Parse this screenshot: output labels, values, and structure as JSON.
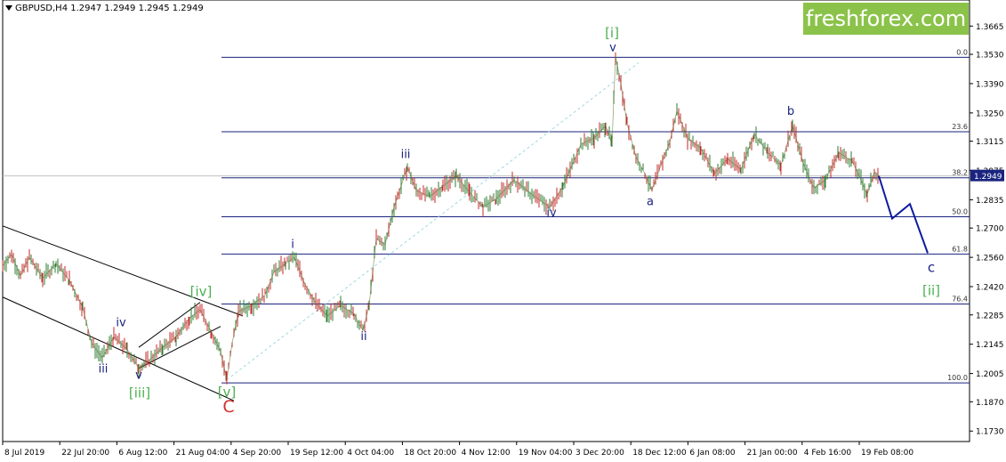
{
  "symbol": {
    "title": "GBPUSD,H4  1.2947 1.2949 1.2945 1.2949"
  },
  "logo": {
    "text": "freshforex.com"
  },
  "chart_data": {
    "type": "line",
    "ylim": [
      1.168,
      1.373
    ],
    "y_ticks": [
      "1.3665",
      "1.3530",
      "1.3390",
      "1.3250",
      "1.3115",
      "1.2975",
      "1.2835",
      "1.2700",
      "1.2560",
      "1.2420",
      "1.2285",
      "1.2145",
      "1.2005",
      "1.1870",
      "1.1730"
    ],
    "x_ticks": [
      "8 Jul 2019",
      "22 Jul 20:00",
      "6 Aug 12:00",
      "21 Aug 04:00",
      "4 Sep 20:00",
      "19 Sep 12:00",
      "4 Oct 04:00",
      "18 Oct 20:00",
      "4 Nov 12:00",
      "19 Nov 04:00",
      "3 Dec 20:00",
      "18 Dec 12:00",
      "6 Jan 08:00",
      "21 Jan 00:00",
      "4 Feb 16:00",
      "19 Feb 08:00"
    ],
    "current_price": "1.2949",
    "fibonacci": [
      {
        "label": "0.0",
        "value": 1.3516
      },
      {
        "label": "23.6",
        "value": 1.316
      },
      {
        "label": "38.2",
        "value": 1.294
      },
      {
        "label": "50.0",
        "value": 1.2754
      },
      {
        "label": "61.8",
        "value": 1.2576
      },
      {
        "label": "76.4",
        "value": 1.2337
      },
      {
        "label": "100.0",
        "value": 1.196
      }
    ],
    "price_path": [
      {
        "t": 0,
        "p": 1.252
      },
      {
        "t": 10,
        "p": 1.2575
      },
      {
        "t": 20,
        "p": 1.247
      },
      {
        "t": 30,
        "p": 1.256
      },
      {
        "t": 45,
        "p": 1.246
      },
      {
        "t": 60,
        "p": 1.253
      },
      {
        "t": 75,
        "p": 1.245
      },
      {
        "t": 90,
        "p": 1.232
      },
      {
        "t": 100,
        "p": 1.215
      },
      {
        "t": 112,
        "p": 1.208
      },
      {
        "t": 125,
        "p": 1.218
      },
      {
        "t": 140,
        "p": 1.212
      },
      {
        "t": 153,
        "p": 1.203
      },
      {
        "t": 165,
        "p": 1.207
      },
      {
        "t": 180,
        "p": 1.213
      },
      {
        "t": 195,
        "p": 1.218
      },
      {
        "t": 210,
        "p": 1.227
      },
      {
        "t": 222,
        "p": 1.231
      },
      {
        "t": 235,
        "p": 1.22
      },
      {
        "t": 245,
        "p": 1.211
      },
      {
        "t": 252,
        "p": 1.1975
      },
      {
        "t": 258,
        "p": 1.215
      },
      {
        "t": 265,
        "p": 1.23
      },
      {
        "t": 280,
        "p": 1.233
      },
      {
        "t": 295,
        "p": 1.238
      },
      {
        "t": 305,
        "p": 1.249
      },
      {
        "t": 318,
        "p": 1.253
      },
      {
        "t": 328,
        "p": 1.256
      },
      {
        "t": 340,
        "p": 1.243
      },
      {
        "t": 352,
        "p": 1.234
      },
      {
        "t": 365,
        "p": 1.228
      },
      {
        "t": 380,
        "p": 1.233
      },
      {
        "t": 395,
        "p": 1.229
      },
      {
        "t": 405,
        "p": 1.221
      },
      {
        "t": 412,
        "p": 1.233
      },
      {
        "t": 420,
        "p": 1.265
      },
      {
        "t": 430,
        "p": 1.262
      },
      {
        "t": 440,
        "p": 1.28
      },
      {
        "t": 455,
        "p": 1.299
      },
      {
        "t": 465,
        "p": 1.288
      },
      {
        "t": 480,
        "p": 1.285
      },
      {
        "t": 495,
        "p": 1.29
      },
      {
        "t": 510,
        "p": 1.295
      },
      {
        "t": 525,
        "p": 1.287
      },
      {
        "t": 540,
        "p": 1.28
      },
      {
        "t": 555,
        "p": 1.284
      },
      {
        "t": 575,
        "p": 1.293
      },
      {
        "t": 595,
        "p": 1.286
      },
      {
        "t": 615,
        "p": 1.28
      },
      {
        "t": 630,
        "p": 1.29
      },
      {
        "t": 650,
        "p": 1.31
      },
      {
        "t": 665,
        "p": 1.313
      },
      {
        "t": 678,
        "p": 1.319
      },
      {
        "t": 685,
        "p": 1.31
      },
      {
        "t": 689,
        "p": 1.352
      },
      {
        "t": 695,
        "p": 1.339
      },
      {
        "t": 702,
        "p": 1.32
      },
      {
        "t": 712,
        "p": 1.304
      },
      {
        "t": 722,
        "p": 1.296
      },
      {
        "t": 730,
        "p": 1.288
      },
      {
        "t": 740,
        "p": 1.3
      },
      {
        "t": 750,
        "p": 1.311
      },
      {
        "t": 758,
        "p": 1.326
      },
      {
        "t": 770,
        "p": 1.313
      },
      {
        "t": 785,
        "p": 1.308
      },
      {
        "t": 800,
        "p": 1.296
      },
      {
        "t": 815,
        "p": 1.303
      },
      {
        "t": 830,
        "p": 1.298
      },
      {
        "t": 845,
        "p": 1.315
      },
      {
        "t": 860,
        "p": 1.306
      },
      {
        "t": 875,
        "p": 1.3
      },
      {
        "t": 888,
        "p": 1.319
      },
      {
        "t": 900,
        "p": 1.301
      },
      {
        "t": 912,
        "p": 1.289
      },
      {
        "t": 925,
        "p": 1.293
      },
      {
        "t": 940,
        "p": 1.306
      },
      {
        "t": 955,
        "p": 1.302
      },
      {
        "t": 965,
        "p": 1.293
      },
      {
        "t": 972,
        "p": 1.286
      },
      {
        "t": 980,
        "p": 1.297
      },
      {
        "t": 985,
        "p": 1.2949
      }
    ],
    "forecast_path": [
      {
        "t": 985,
        "p": 1.2949
      },
      {
        "t": 1000,
        "p": 1.2745
      },
      {
        "t": 1020,
        "p": 1.2815
      },
      {
        "t": 1040,
        "p": 1.258
      }
    ],
    "channel_lines": [
      {
        "t1": 0,
        "p1": 1.271,
        "t2": 270,
        "p2": 1.228
      },
      {
        "t1": 0,
        "p1": 1.237,
        "t2": 260,
        "p2": 1.1875
      }
    ],
    "triangle_lines": [
      {
        "t1": 153,
        "p1": 1.213,
        "t2": 222,
        "p2": 1.2345
      },
      {
        "t1": 153,
        "p1": 1.203,
        "t2": 245,
        "p2": 1.223
      }
    ],
    "dashed_line": {
      "t1": 252,
      "p1": 1.1975,
      "t2": 715,
      "p2": 1.349
    },
    "wave_labels": [
      {
        "text": "[i]",
        "t": 685,
        "p": 1.361,
        "color": "#4caf50",
        "size": 15
      },
      {
        "text": "v",
        "t": 686,
        "p": 1.3545,
        "color": "#1a237e",
        "size": 13
      },
      {
        "text": "iii",
        "t": 453,
        "p": 1.3035,
        "color": "#1a237e",
        "size": 13
      },
      {
        "text": "i",
        "t": 326,
        "p": 1.2605,
        "color": "#1a237e",
        "size": 13
      },
      {
        "text": "ii",
        "t": 406,
        "p": 1.2165,
        "color": "#1a237e",
        "size": 13
      },
      {
        "text": "iv",
        "t": 617,
        "p": 1.2755,
        "color": "#1a237e",
        "size": 13
      },
      {
        "text": "a",
        "t": 728,
        "p": 1.281,
        "color": "#1a237e",
        "size": 13
      },
      {
        "text": "b",
        "t": 886,
        "p": 1.324,
        "color": "#1a237e",
        "size": 13
      },
      {
        "text": "c",
        "t": 1044,
        "p": 1.249,
        "color": "#1a237e",
        "size": 15
      },
      {
        "text": "[ii]",
        "t": 1044,
        "p": 1.238,
        "color": "#4caf50",
        "size": 15
      },
      {
        "text": "iv",
        "t": 133,
        "p": 1.223,
        "color": "#1a237e",
        "size": 13
      },
      {
        "text": "iii",
        "t": 113,
        "p": 1.201,
        "color": "#1a237e",
        "size": 13
      },
      {
        "text": "v",
        "t": 153,
        "p": 1.198,
        "color": "#1a237e",
        "size": 13
      },
      {
        "text": "[iii]",
        "t": 154,
        "p": 1.189,
        "color": "#4caf50",
        "size": 15
      },
      {
        "text": "[iv]",
        "t": 223,
        "p": 1.2375,
        "color": "#4caf50",
        "size": 15
      },
      {
        "text": "[v]",
        "t": 252,
        "p": 1.1895,
        "color": "#4caf50",
        "size": 15
      },
      {
        "text": "C",
        "t": 254,
        "p": 1.182,
        "color": "#d32f2f",
        "size": 19
      }
    ]
  }
}
